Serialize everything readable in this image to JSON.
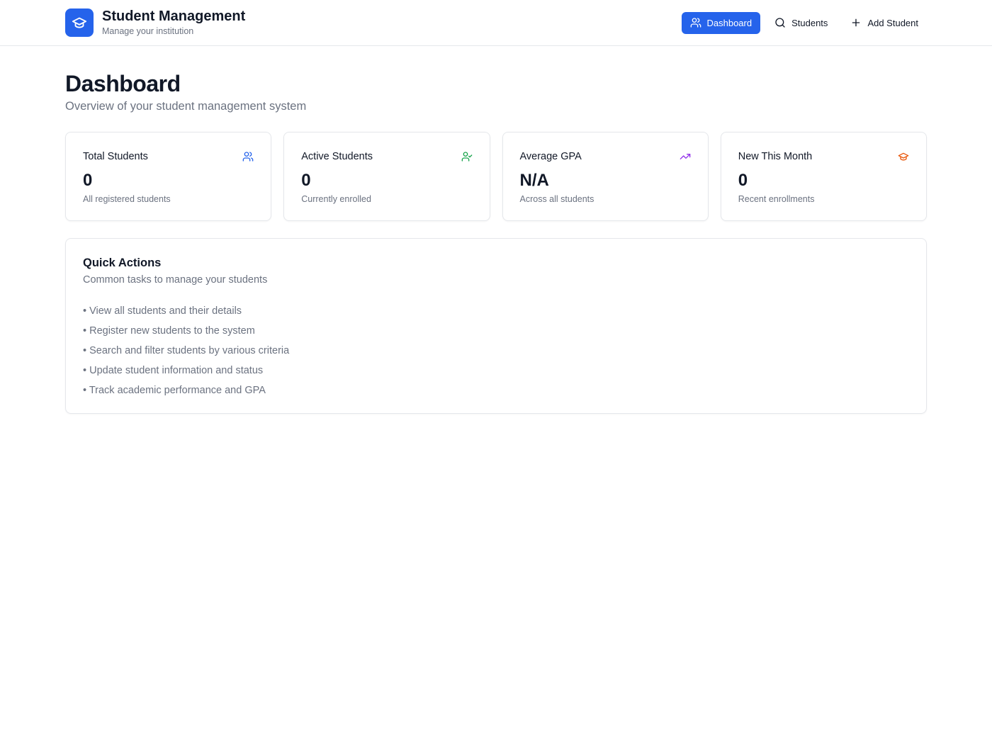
{
  "header": {
    "title": "Student Management",
    "subtitle": "Manage your institution",
    "logo_icon": "graduation-cap-icon",
    "accent": "#2563eb",
    "nav": [
      {
        "label": "Dashboard",
        "icon": "users-icon",
        "active": true
      },
      {
        "label": "Students",
        "icon": "search-icon",
        "active": false
      },
      {
        "label": "Add Student",
        "icon": "plus-icon",
        "active": false
      }
    ]
  },
  "page": {
    "title": "Dashboard",
    "subtitle": "Overview of your student management system"
  },
  "stats": [
    {
      "label": "Total Students",
      "value": "0",
      "description": "All registered students",
      "icon": "users-icon",
      "icon_color": "#2563eb"
    },
    {
      "label": "Active Students",
      "value": "0",
      "description": "Currently enrolled",
      "icon": "user-check-icon",
      "icon_color": "#16a34a"
    },
    {
      "label": "Average GPA",
      "value": "N/A",
      "description": "Across all students",
      "icon": "trending-up-icon",
      "icon_color": "#9333ea"
    },
    {
      "label": "New This Month",
      "value": "0",
      "description": "Recent enrollments",
      "icon": "graduation-cap-icon",
      "icon_color": "#ea580c"
    }
  ],
  "quick_actions": {
    "title": "Quick Actions",
    "subtitle": "Common tasks to manage your students",
    "items": [
      "• View all students and their details",
      "• Register new students to the system",
      "• Search and filter students by various criteria",
      "• Update student information and status",
      "• Track academic performance and GPA"
    ]
  }
}
